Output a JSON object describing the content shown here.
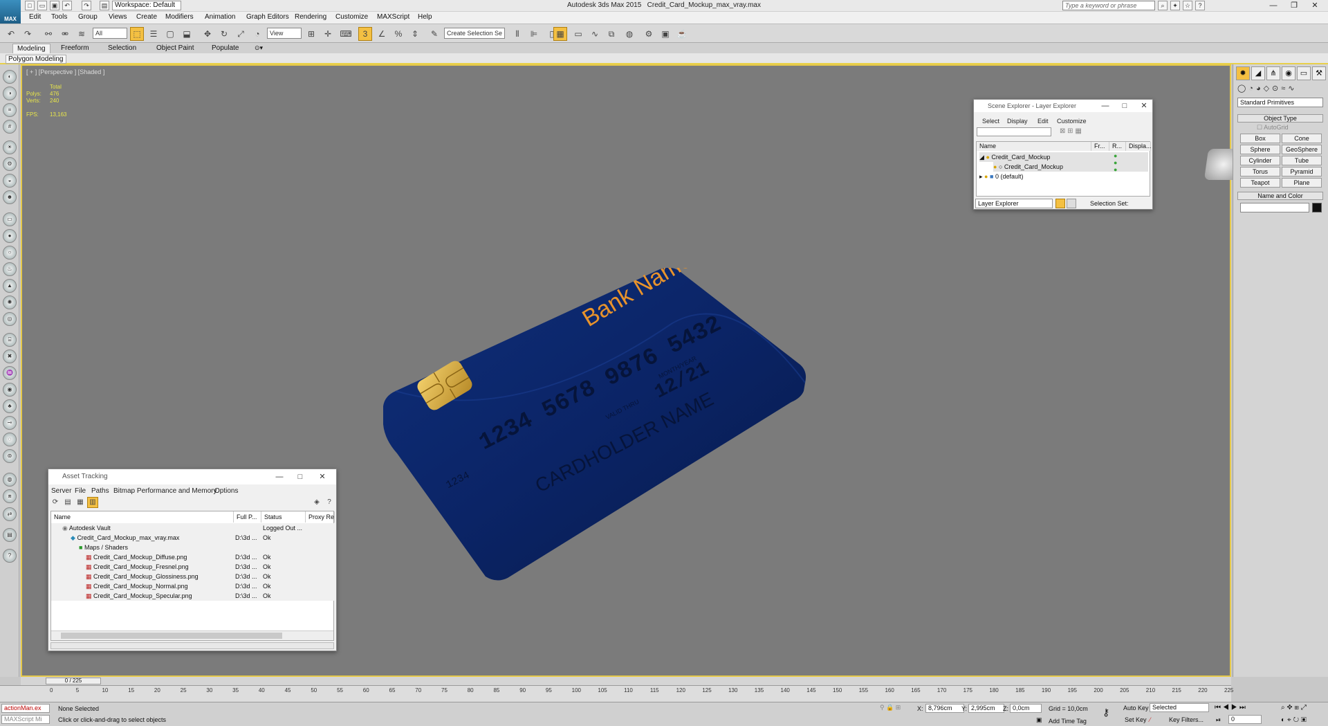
{
  "window": {
    "app_title": "Autodesk 3ds Max  2015",
    "file_title": "Credit_Card_Mockup_max_vray.max",
    "logo_text": "MAX",
    "workspace": "Workspace: Default",
    "search_placeholder": "Type a keyword or phrase",
    "minimize": "—",
    "restore": "❐",
    "close": "✕"
  },
  "menu": [
    "Edit",
    "Tools",
    "Group",
    "Views",
    "Create",
    "Modifiers",
    "Animation",
    "Graph Editors",
    "Rendering",
    "Customize",
    "MAXScript",
    "Help"
  ],
  "toolbar": {
    "filter": "All",
    "ref_coord": "View",
    "snap_label": "3",
    "selection_set": "Create Selection Se"
  },
  "ribbon": {
    "tabs": [
      "Modeling",
      "Freeform",
      "Selection",
      "Object Paint",
      "Populate"
    ],
    "active_tab": "Modeling",
    "sub_label": "Polygon Modeling"
  },
  "viewport": {
    "label": "[ + ] [Perspective ] [Shaded ]",
    "stats_total": "Total",
    "polys_label": "Polys:",
    "polys_value": "476",
    "verts_label": "Verts:",
    "verts_value": "240",
    "fps_label": "FPS:",
    "fps_value": "13,163",
    "card": {
      "bank_name": "Bank Name",
      "number": "1234   5678   9876   5432",
      "small_number": "1234",
      "valid_thru": "VALID THRU",
      "month_year": "MONTH/YEAR",
      "expiry": "12/21",
      "holder": "CARDHOLDER NAME",
      "color": "#0c2a6e",
      "accent": "#e8932c"
    }
  },
  "scene_explorer": {
    "title": "Scene Explorer - Layer Explorer",
    "menu": [
      "Select",
      "Display",
      "Edit",
      "Customize"
    ],
    "columns": [
      "Name",
      "Fr...",
      "R...",
      "Displa..."
    ],
    "rows": [
      "Credit_Card_Mockup",
      "Credit_Card_Mockup",
      "0 (default)"
    ],
    "explorer_select": "Layer Explorer",
    "selection_set": "Selection Set:"
  },
  "asset_tracking": {
    "title": "Asset Tracking",
    "menu": [
      "Server",
      "File",
      "Paths",
      "Bitmap Performance and Memory",
      "Options"
    ],
    "columns": [
      "Name",
      "Full P...",
      "Status",
      "Proxy Re"
    ],
    "rows": [
      {
        "name": "Autodesk Vault",
        "path": "",
        "status": "Logged Out ..."
      },
      {
        "name": "Credit_Card_Mockup_max_vray.max",
        "path": "D:\\3d ...",
        "status": "Ok"
      },
      {
        "name": "Maps / Shaders",
        "path": "",
        "status": ""
      },
      {
        "name": "Credit_Card_Mockup_Diffuse.png",
        "path": "D:\\3d ...",
        "status": "Ok"
      },
      {
        "name": "Credit_Card_Mockup_Fresnel.png",
        "path": "D:\\3d ...",
        "status": "Ok"
      },
      {
        "name": "Credit_Card_Mockup_Glossiness.png",
        "path": "D:\\3d ...",
        "status": "Ok"
      },
      {
        "name": "Credit_Card_Mockup_Normal.png",
        "path": "D:\\3d ...",
        "status": "Ok"
      },
      {
        "name": "Credit_Card_Mockup_Specular.png",
        "path": "D:\\3d ...",
        "status": "Ok"
      }
    ]
  },
  "command_panel": {
    "primitive_type": "Standard Primitives",
    "object_type": "Object Type",
    "autogrid": "AutoGrid",
    "buttons": [
      "Box",
      "Cone",
      "Sphere",
      "GeoSphere",
      "Cylinder",
      "Tube",
      "Torus",
      "Pyramid",
      "Teapot",
      "Plane"
    ],
    "name_color": "Name and Color",
    "swatch_color": "#111111"
  },
  "timeline": {
    "frame": "0 / 225",
    "ticks": [
      "0",
      "5",
      "10",
      "15",
      "20",
      "25",
      "30",
      "35",
      "40",
      "45",
      "50",
      "55",
      "60",
      "65",
      "70",
      "75",
      "80",
      "85",
      "90",
      "95",
      "100",
      "105",
      "110",
      "115",
      "120",
      "125",
      "130",
      "135",
      "140",
      "145",
      "150",
      "155",
      "160",
      "165",
      "170",
      "175",
      "180",
      "185",
      "190",
      "195",
      "200",
      "205",
      "210",
      "215",
      "220",
      "225"
    ]
  },
  "status": {
    "script_listener": "actionMan.ex",
    "maxscript": "MAXScript Mi",
    "selection": "None Selected",
    "prompt": "Click or click-and-drag to select objects",
    "x_label": "X:",
    "x": "8,796cm",
    "y_label": "Y:",
    "y": "2,995cm",
    "z_label": "Z:",
    "z": "0,0cm",
    "grid": "Grid = 10,0cm",
    "add_time_tag": "Add Time Tag",
    "auto_key": "Auto Key",
    "set_key": "Set Key",
    "key_mode": "Selected",
    "key_filters": "Key Filters...",
    "frame_field": "0"
  }
}
